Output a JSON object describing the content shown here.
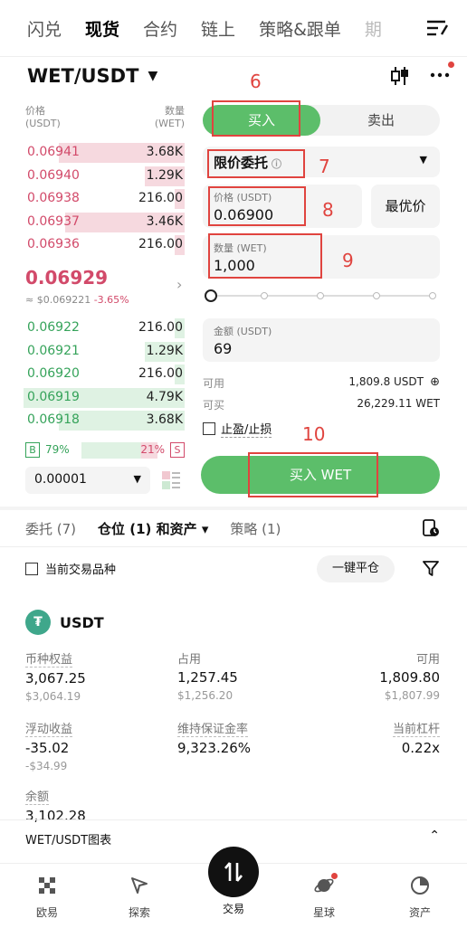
{
  "top_tabs": [
    "闪兑",
    "现货",
    "合约",
    "链上",
    "策略&跟单",
    "期"
  ],
  "pair": "WET/USDT",
  "orderbook": {
    "price_label": "价格",
    "price_unit": "(USDT)",
    "qty_label": "数量",
    "qty_unit": "(WET)",
    "asks": [
      {
        "price": "0.06941",
        "qty": "3.68K",
        "depth": 0.78
      },
      {
        "price": "0.06940",
        "qty": "1.29K",
        "depth": 0.25
      },
      {
        "price": "0.06938",
        "qty": "216.00",
        "depth": 0.06
      },
      {
        "price": "0.06937",
        "qty": "3.46K",
        "depth": 0.74
      },
      {
        "price": "0.06936",
        "qty": "216.00",
        "depth": 0.06
      }
    ],
    "last_price": "0.06929",
    "last_usd": "≈ $0.069221",
    "last_change": "-3.65%",
    "bids": [
      {
        "price": "0.06922",
        "qty": "216.00",
        "depth": 0.06
      },
      {
        "price": "0.06921",
        "qty": "1.29K",
        "depth": 0.25
      },
      {
        "price": "0.06920",
        "qty": "216.00",
        "depth": 0.06
      },
      {
        "price": "0.06919",
        "qty": "4.79K",
        "depth": 1.0
      },
      {
        "price": "0.06918",
        "qty": "3.68K",
        "depth": 0.78
      }
    ],
    "buy_tag": "B",
    "buy_pct": "79%",
    "sell_pct": "21%",
    "sell_tag": "S",
    "precision": "0.00001"
  },
  "trade": {
    "buy_tab": "买入",
    "sell_tab": "卖出",
    "order_type": "限价委托",
    "price_label": "价格 (USDT)",
    "price_value": "0.06900",
    "best_price": "最优价",
    "qty_label": "数量 (WET)",
    "qty_value": "1,000",
    "amount_label": "金额 (USDT)",
    "amount_value": "69",
    "avail_label": "可用",
    "avail_value": "1,809.8 USDT",
    "canbuy_label": "可买",
    "canbuy_value": "26,229.11 WET",
    "tpsl_label": "止盈/止损",
    "buy_button": "买入 WET"
  },
  "annotations": [
    "6",
    "7",
    "8",
    "9",
    "10"
  ],
  "positions_tabs": [
    "委托 (7)",
    "仓位 (1) 和资产",
    "策略 (1)"
  ],
  "current_pair_label": "当前交易品种",
  "close_all": "一键平仓",
  "asset": {
    "name": "USDT",
    "equity_label": "币种权益",
    "equity": "3,067.25",
    "equity_usd": "$3,064.19",
    "used_label": "占用",
    "used": "1,257.45",
    "used_usd": "$1,256.20",
    "avail_label": "可用",
    "avail": "1,809.80",
    "avail_usd": "$1,807.99",
    "upl_label": "浮动收益",
    "upl": "-35.02",
    "upl_usd": "-$34.99",
    "mmr_label": "维持保证金率",
    "mmr": "9,323.26%",
    "lev_label": "当前杠杆",
    "lev": "0.22x",
    "balance_label": "余额",
    "balance": "3,102.28"
  },
  "chart_bar": "WET/USDT图表",
  "bottom_nav": [
    "欧易",
    "探索",
    "交易",
    "星球",
    "资产"
  ],
  "colors": {
    "buy": "#5cbe6a",
    "sell": "#d24a6a",
    "annotation": "#e0443f"
  }
}
